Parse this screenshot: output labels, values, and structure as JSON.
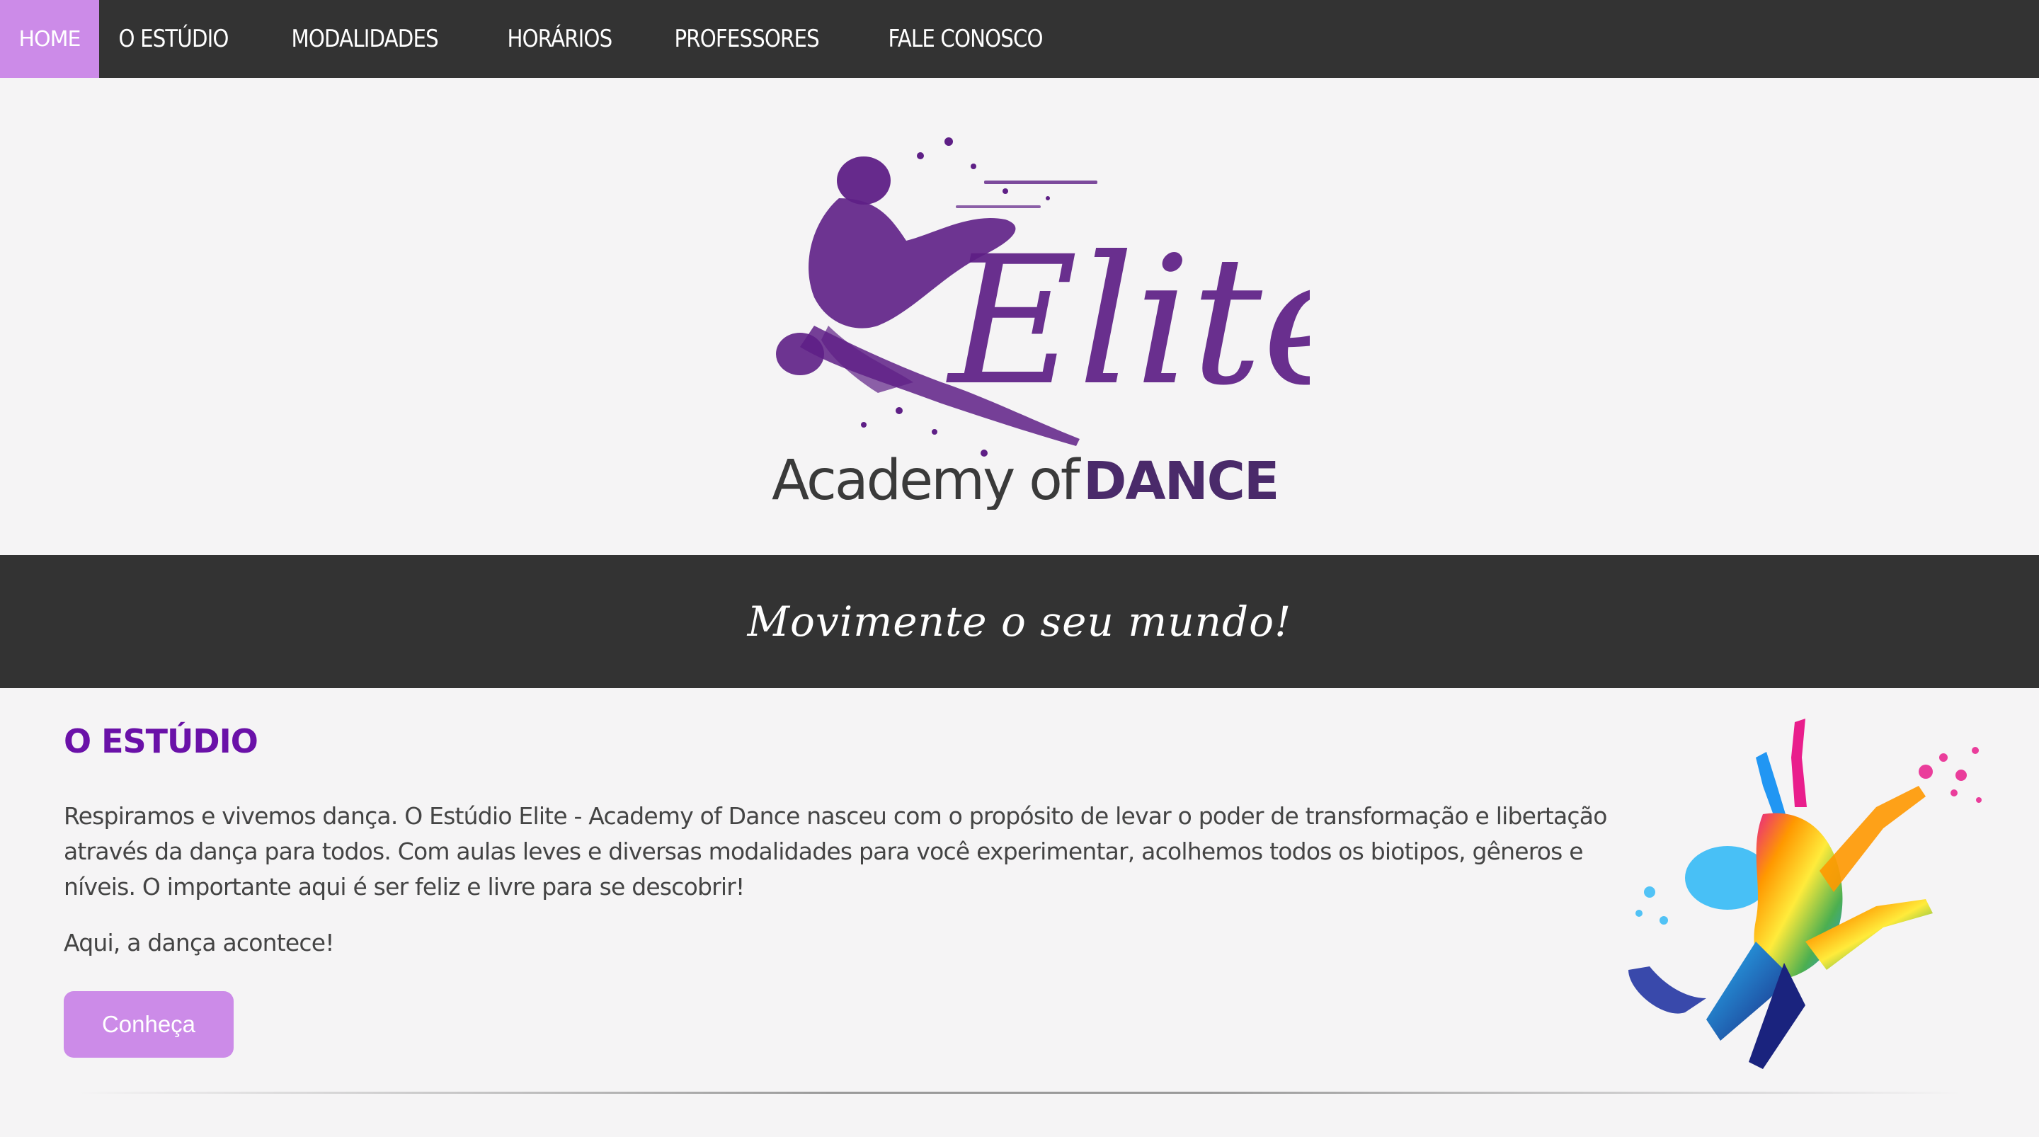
{
  "nav": {
    "items": [
      {
        "label": "HOME",
        "active": true
      },
      {
        "label": "O ESTÚDIO"
      },
      {
        "label": "MODALIDADES"
      },
      {
        "label": "HORÁRIOS"
      },
      {
        "label": "PROFESSORES"
      },
      {
        "label": "FALE CONOSCO"
      }
    ]
  },
  "logo": {
    "script_text": "Elite",
    "subtitle_light": "Academy of",
    "subtitle_bold": "DANCE"
  },
  "banner": {
    "text": "Movimente o seu mundo!"
  },
  "studio": {
    "title": "O ESTÚDIO",
    "paragraph": "Respiramos e vivemos dança. O Estúdio Elite - Academy of Dance nasceu com o propósito de levar o poder de transformação e libertação através da dança para todos. Com aulas leves e diversas modalidades para você experimentar, acolhemos todos os biotipos, gêneros e níveis. O importante aqui é ser feliz e livre para se descobrir!",
    "tagline": "Aqui, a dança acontece!",
    "button_label": "Conheça"
  },
  "colors": {
    "nav_bg": "#333333",
    "accent": "#cc8be8",
    "title_purple": "#6a11a8",
    "logo_purple": "#5e1f86"
  }
}
